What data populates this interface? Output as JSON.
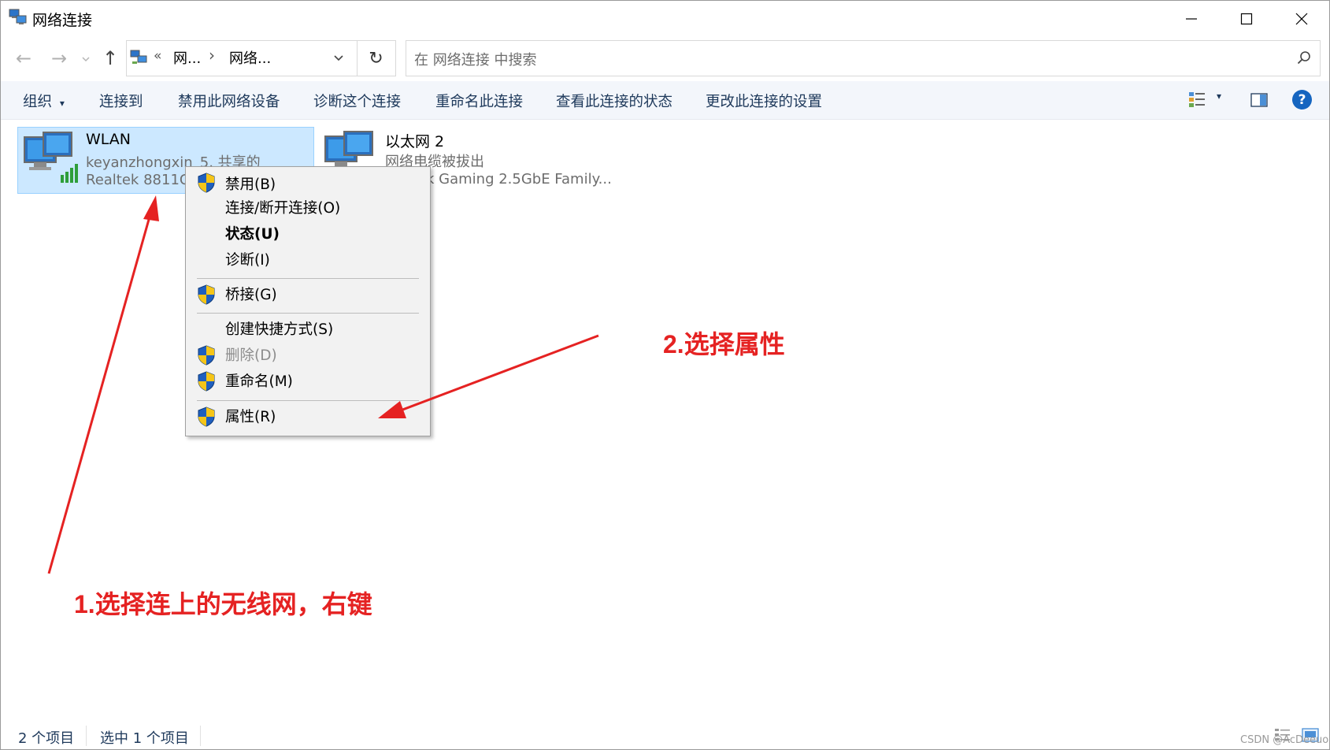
{
  "window": {
    "title": "网络连接",
    "minimize_glyph": "—",
    "maximize_glyph": "☐",
    "close_glyph": "✕"
  },
  "address_bar": {
    "back_glyph": "←",
    "forward_glyph": "→",
    "up_glyph": "↑",
    "overflow_glyph": "«",
    "crumbs": [
      "网...",
      "网络..."
    ],
    "crumb_sep": "›",
    "dropdown_glyph": "⌄",
    "refresh_glyph": "↻"
  },
  "search": {
    "placeholder": "在 网络连接 中搜索",
    "icon": "search-icon"
  },
  "toolbar": {
    "organize": "组织",
    "organize_caret": "▾",
    "connect_to": "连接到",
    "disable_device": "禁用此网络设备",
    "diagnose": "诊断这个连接",
    "rename": "重命名此连接",
    "view_status": "查看此连接的状态",
    "change_settings": "更改此连接的设置",
    "view_caret": "▾",
    "help": "?"
  },
  "items": [
    {
      "name": "WLAN",
      "line2": "keyanzhongxin_5, 共享的",
      "line3": "Realtek 8811C",
      "selected": true,
      "icon": "wireless-network-adapter-icon"
    },
    {
      "name": "以太网 2",
      "line2": "网络电缆被拔出",
      "line3": "k Gaming 2.5GbE Family...",
      "selected": false,
      "icon": "ethernet-adapter-icon"
    }
  ],
  "context_menu": {
    "disable": "禁用(B)",
    "connect": "连接/断开连接(O)",
    "status": "状态(U)",
    "diagnose": "诊断(I)",
    "bridge": "桥接(G)",
    "shortcut": "创建快捷方式(S)",
    "delete": "删除(D)",
    "rename": "重命名(M)",
    "properties": "属性(R)"
  },
  "status_bar": {
    "count": "2 个项目",
    "selected": "选中 1 个项目"
  },
  "annotations": {
    "step1": "1.选择连上的无线网，右键",
    "step2": "2.选择属性",
    "color": "#e52222"
  },
  "watermark": "CSDN @AcDeeuo"
}
